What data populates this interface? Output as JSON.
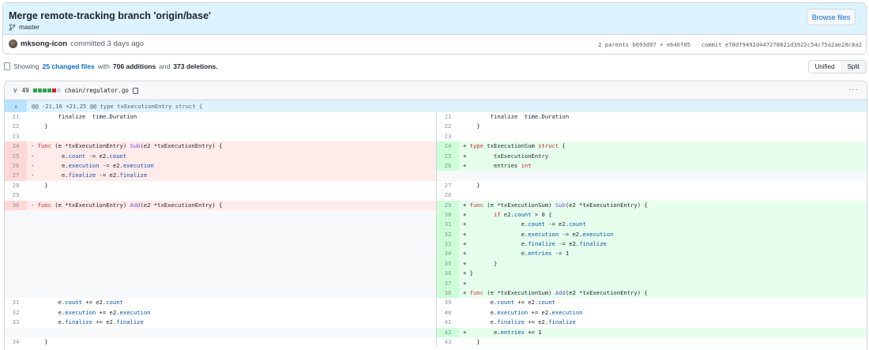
{
  "commit": {
    "title": "Merge remote-tracking branch 'origin/base'",
    "branch": "master",
    "browse_label": "Browse files",
    "author": "mksong-icon",
    "committed_text": "committed 3 days ago",
    "parents_text": "2 parents b693d97 + e646f05",
    "commit_text": "commit e70df9492d447278821d3922c54c75a2ae28c8a2"
  },
  "summary": {
    "prefix": "Showing",
    "changed_files": "25 changed files",
    "with": "with",
    "additions": "706 additions",
    "and": "and",
    "deletions": "373 deletions."
  },
  "view_toggle": {
    "unified": "Unified",
    "split": "Split"
  },
  "file": {
    "chevron": "∨",
    "change_count": "49",
    "diffstat_blocks": [
      "add",
      "add",
      "add",
      "add",
      "del",
      "neutral"
    ],
    "path": "chain/regulator.go",
    "more": "···",
    "hunk_header": "@@ -21,16 +21,25 @@ type txExecutionEntry struct {",
    "hunk_expand": "↕"
  },
  "colors": {
    "add_block": "#2da44e",
    "del_block": "#cf222e",
    "neutral_block": "#d0d7de"
  },
  "rows": [
    {
      "l": {
        "n": "21",
        "c": "\t\tfinalize  time.Duration"
      },
      "r": {
        "n": "21",
        "c": "\t\tfinalize  time.Duration"
      }
    },
    {
      "l": {
        "n": "22",
        "c": "\t}"
      },
      "r": {
        "n": "22",
        "c": "\t}"
      }
    },
    {
      "l": {
        "n": "23",
        "c": ""
      },
      "r": {
        "n": "23",
        "c": ""
      }
    },
    {
      "l": {
        "n": "24",
        "t": "del",
        "c": "- func (e *txExecutionEntry) Sub(e2 *txExecutionEntry) {"
      },
      "r": {
        "n": "24",
        "t": "add",
        "c": "+ type txExecutionSum struct {"
      }
    },
    {
      "l": {
        "n": "25",
        "t": "del",
        "c": "-\t\te.count -= e2.count"
      },
      "r": {
        "n": "25",
        "t": "add",
        "c": "+\t\ttxExecutionEntry"
      }
    },
    {
      "l": {
        "n": "26",
        "t": "del",
        "c": "-\t\te.execution -= e2.execution"
      },
      "r": {
        "n": "26",
        "t": "add",
        "c": "+\t\tentries int"
      }
    },
    {
      "l": {
        "n": "27",
        "t": "del",
        "c": "-\t\te.finalize -= e2.finalize"
      },
      "r": {
        "t": "empty"
      }
    },
    {
      "l": {
        "n": "28",
        "c": "\t}"
      },
      "r": {
        "n": "27",
        "c": "\t}"
      }
    },
    {
      "l": {
        "n": "29",
        "c": ""
      },
      "r": {
        "n": "28",
        "c": ""
      }
    },
    {
      "l": {
        "n": "30",
        "t": "del",
        "c": "- func (e *txExecutionEntry) Add(e2 *txExecutionEntry) {"
      },
      "r": {
        "n": "29",
        "t": "add",
        "c": "+ func (e *txExecutionSum) Sub(e2 *txExecutionEntry) {"
      }
    },
    {
      "l": {
        "t": "empty"
      },
      "r": {
        "n": "30",
        "t": "add",
        "c": "+\t\tif e2.count > 0 {"
      }
    },
    {
      "l": {
        "t": "empty"
      },
      "r": {
        "n": "31",
        "t": "add",
        "c": "+\t\t\t\te.count -= e2.count"
      }
    },
    {
      "l": {
        "t": "empty"
      },
      "r": {
        "n": "32",
        "t": "add",
        "c": "+\t\t\t\te.execution -= e2.execution"
      }
    },
    {
      "l": {
        "t": "empty"
      },
      "r": {
        "n": "33",
        "t": "add",
        "c": "+\t\t\t\te.finalize -= e2.finalize"
      }
    },
    {
      "l": {
        "t": "empty"
      },
      "r": {
        "n": "34",
        "t": "add",
        "c": "+\t\t\t\te.entries -= 1"
      }
    },
    {
      "l": {
        "t": "empty"
      },
      "r": {
        "n": "35",
        "t": "add",
        "c": "+\t\t}"
      }
    },
    {
      "l": {
        "t": "empty"
      },
      "r": {
        "n": "36",
        "t": "add",
        "c": "+ }"
      }
    },
    {
      "l": {
        "t": "empty"
      },
      "r": {
        "n": "37",
        "t": "add",
        "c": "+"
      }
    },
    {
      "l": {
        "t": "empty"
      },
      "r": {
        "n": "38",
        "t": "add",
        "c": "+ func (e *txExecutionSum) Add(e2 *txExecutionEntry) {"
      }
    },
    {
      "l": {
        "n": "31",
        "c": "\t\te.count += e2.count"
      },
      "r": {
        "n": "39",
        "c": "\t\te.count += e2.count"
      }
    },
    {
      "l": {
        "n": "32",
        "c": "\t\te.execution += e2.execution"
      },
      "r": {
        "n": "40",
        "c": "\t\te.execution += e2.execution"
      }
    },
    {
      "l": {
        "n": "33",
        "c": "\t\te.finalize += e2.finalize"
      },
      "r": {
        "n": "41",
        "c": "\t\te.finalize += e2.finalize"
      }
    },
    {
      "l": {
        "t": "empty"
      },
      "r": {
        "n": "42",
        "t": "add",
        "c": "+\t\te.entries += 1"
      }
    },
    {
      "l": {
        "n": "34",
        "c": "\t}"
      },
      "r": {
        "n": "43",
        "c": "\t}"
      }
    }
  ]
}
